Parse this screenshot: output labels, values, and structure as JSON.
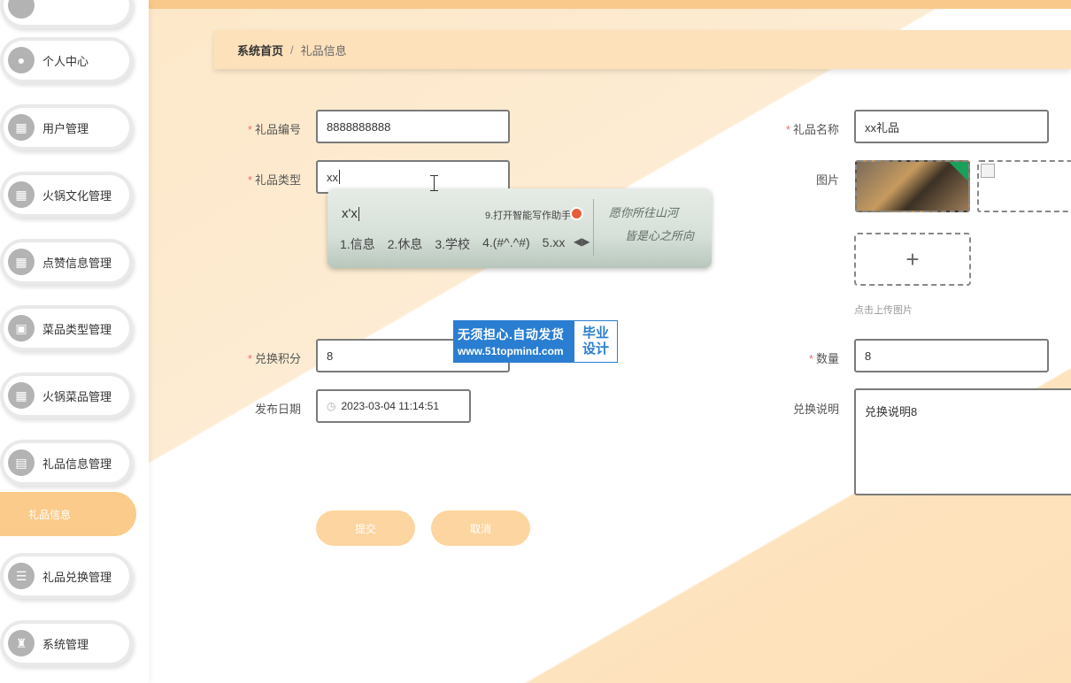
{
  "sidebar": {
    "items": [
      {
        "label": "个人中心",
        "icon": "user-icon"
      },
      {
        "label": "用户管理",
        "icon": "grid-icon"
      },
      {
        "label": "火锅文化管理",
        "icon": "grid-icon"
      },
      {
        "label": "点赞信息管理",
        "icon": "grid-icon"
      },
      {
        "label": "菜品类型管理",
        "icon": "image-icon"
      },
      {
        "label": "火锅菜品管理",
        "icon": "grid-icon"
      },
      {
        "label": "礼品信息管理",
        "icon": "bag-icon"
      },
      {
        "label": "礼品兑换管理",
        "icon": "list-icon"
      },
      {
        "label": "系统管理",
        "icon": "trophy-icon"
      }
    ],
    "active_sub": "礼品信息"
  },
  "breadcrumb": {
    "home": "系统首页",
    "separator": "/",
    "current": "礼品信息"
  },
  "form": {
    "gift_no": {
      "label": "礼品编号",
      "value": "8888888888"
    },
    "gift_name": {
      "label": "礼品名称",
      "value": "xx礼品"
    },
    "gift_type": {
      "label": "礼品类型",
      "value": "xx"
    },
    "image": {
      "label": "图片",
      "upload_tip": "点击上传图片",
      "upload_symbol": "+"
    },
    "points": {
      "label": "兑换积分",
      "value": "8"
    },
    "quantity": {
      "label": "数量",
      "value": "8"
    },
    "publish_date": {
      "label": "发布日期",
      "value": "2023-03-04 11:14:51"
    },
    "description": {
      "label": "兑换说明",
      "value": "兑换说明8"
    },
    "required_mark": "*"
  },
  "buttons": {
    "submit": "提交",
    "cancel": "取消"
  },
  "ime": {
    "input": "x'x",
    "assistant": "9.打开智能写作助手",
    "candidates": [
      "1.信息",
      "2.休息",
      "3.学校",
      "4.(#^.^#)",
      "5.xx"
    ],
    "art_line1": "愿你所往山河",
    "art_line2": "皆是心之所向"
  },
  "watermark": {
    "line1": "无须担心.自动发货",
    "line2": "www.51topmind.com",
    "right1": "毕业",
    "right2": "设计"
  },
  "colors": {
    "accent": "#fbcb8b",
    "breadcrumb_bg": "#fde1bb",
    "required": "#f56c6c",
    "watermark": "#2a7ed1"
  }
}
